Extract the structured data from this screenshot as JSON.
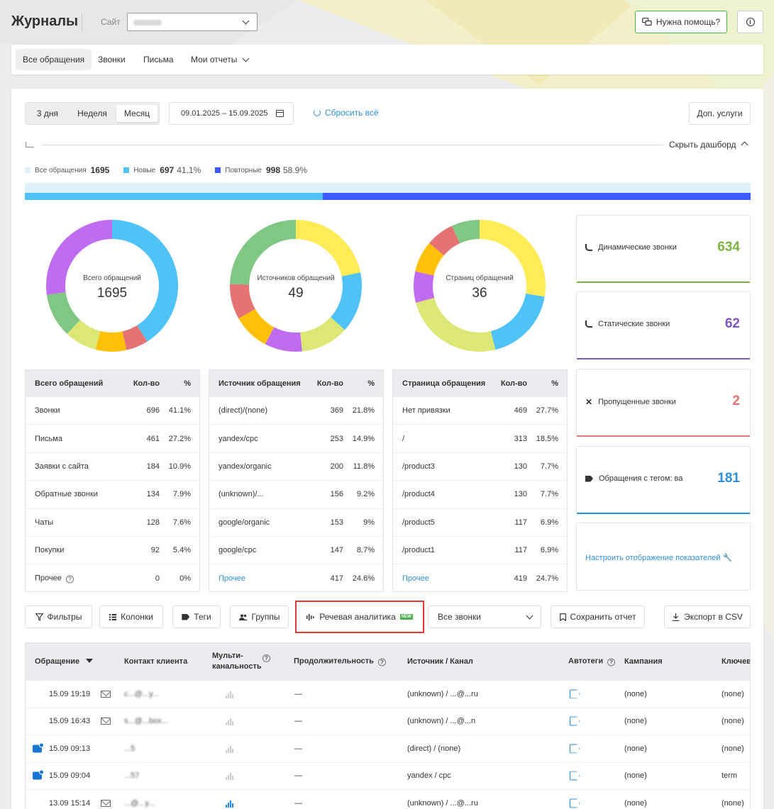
{
  "header": {
    "title": "Журналы",
    "site_label": "Сайт",
    "help_label": "Нужна помощь?"
  },
  "tabs": [
    {
      "label": "Все обращения"
    },
    {
      "label": "Звонки"
    },
    {
      "label": "Письма"
    },
    {
      "label": "Мои отчеты"
    }
  ],
  "period": {
    "options": [
      "3 дня",
      "Неделя",
      "Месяц"
    ],
    "selected": "Месяц",
    "date_range": "09.01.2025 – 15.09.2025",
    "reset_label": "Сбросить всё",
    "extra_services": "Доп. услуги"
  },
  "dashboard": {
    "hide_label": "Скрыть дашборд"
  },
  "summary": {
    "all": {
      "label": "Все обращения",
      "value": "1695"
    },
    "new": {
      "label": "Новые",
      "value": "697",
      "pct": "41.1%"
    },
    "repeat": {
      "label": "Повторные",
      "value": "998",
      "pct": "58.9%"
    }
  },
  "new_share": 0.411,
  "colors": {
    "all": "#ddf2f8",
    "new": "#4fc3f7",
    "repeat": "#3d5afe",
    "dynamic": "#7cb342",
    "static": "#7e57c2",
    "missed": "#e57373",
    "tagged": "#2f8fd6"
  },
  "donuts": [
    {
      "label": "Всего обращений",
      "total": "1695",
      "segments": [
        {
          "value": 696,
          "color": "#4fc3f7"
        },
        {
          "value": 92,
          "color": "#e57373"
        },
        {
          "value": 128,
          "color": "#ffc107"
        },
        {
          "value": 134,
          "color": "#dce775"
        },
        {
          "value": 184,
          "color": "#81c784"
        },
        {
          "value": 461,
          "color": "#c06cf0"
        }
      ]
    },
    {
      "label": "Источников обращений",
      "total": "49",
      "segments": [
        {
          "value": 369,
          "color": "#ffeb55"
        },
        {
          "value": 253,
          "color": "#4fc3f7"
        },
        {
          "value": 200,
          "color": "#dce775"
        },
        {
          "value": 156,
          "color": "#c06cf0"
        },
        {
          "value": 153,
          "color": "#ffc107"
        },
        {
          "value": 147,
          "color": "#e57373"
        },
        {
          "value": 417,
          "color": "#81c784"
        }
      ]
    },
    {
      "label": "Страниц обращений",
      "total": "36",
      "segments": [
        {
          "value": 469,
          "color": "#ffeb55"
        },
        {
          "value": 313,
          "color": "#4fc3f7"
        },
        {
          "value": 419,
          "color": "#dce775"
        },
        {
          "value": 130,
          "color": "#c06cf0"
        },
        {
          "value": 130,
          "color": "#ffc107"
        },
        {
          "value": 117,
          "color": "#e57373"
        },
        {
          "value": 117,
          "color": "#81c784"
        }
      ]
    }
  ],
  "table_all": {
    "headers": [
      "Всего обращений",
      "Кол-во",
      "%"
    ],
    "rows": [
      [
        "Звонки",
        "696",
        "41.1%"
      ],
      [
        "Письма",
        "461",
        "27.2%"
      ],
      [
        "Заявки с сайта",
        "184",
        "10.9%"
      ],
      [
        "Обратные звонки",
        "134",
        "7.9%"
      ],
      [
        "Чаты",
        "128",
        "7.6%"
      ],
      [
        "Покупки",
        "92",
        "5.4%"
      ],
      [
        "Прочее",
        "0",
        "0%"
      ]
    ]
  },
  "table_source": {
    "headers": [
      "Источник обращения",
      "Кол-во",
      "%"
    ],
    "rows": [
      [
        "(direct)/(none)",
        "369",
        "21.8%"
      ],
      [
        "yandex/cpc",
        "253",
        "14.9%"
      ],
      [
        "yandex/organic",
        "200",
        "11.8%"
      ],
      [
        "(unknown)/...",
        "156",
        "9.2%"
      ],
      [
        "google/organic",
        "153",
        "9%"
      ],
      [
        "google/cpc",
        "147",
        "8.7%"
      ],
      [
        "Прочее",
        "417",
        "24.6%"
      ]
    ]
  },
  "table_page": {
    "headers": [
      "Страница обращения",
      "Кол-во",
      "%"
    ],
    "rows": [
      [
        "Нет привязки",
        "469",
        "27.7%"
      ],
      [
        "/",
        "313",
        "18.5%"
      ],
      [
        "/product3",
        "130",
        "7.7%"
      ],
      [
        "/product4",
        "130",
        "7.7%"
      ],
      [
        "/product5",
        "117",
        "6.9%"
      ],
      [
        "/product1",
        "117",
        "6.9%"
      ],
      [
        "Прочее",
        "419",
        "24.7%"
      ]
    ]
  },
  "stats": [
    {
      "label": "Динамические звонки",
      "value": "634"
    },
    {
      "label": "Статические звонки",
      "value": "62"
    },
    {
      "label": "Пропущенные звонки",
      "value": "2"
    },
    {
      "label": "Обращения с тегом: ва",
      "value": "181"
    }
  ],
  "configure_label": "Настроить отображение показателей 🔧",
  "toolbar": {
    "filters": "Фильтры",
    "columns": "Колонки",
    "tags": "Теги",
    "groups": "Группы",
    "speech": "Речевая аналитика",
    "new_badge": "NEW",
    "calls_select": "Все звонки",
    "save_report": "Сохранить отчет",
    "export": "Экспорт в CSV"
  },
  "grid": {
    "headers": {
      "appeal": "Обращение",
      "contact": "Контакт клиента",
      "multi": "Мульти-\nканальность",
      "duration": "Продолжительность",
      "source": "Источник / Канал",
      "autotags": "Автотеги",
      "campaign": "Кампания",
      "keyword": "Ключев"
    },
    "rows": [
      {
        "type": "mail",
        "date": "15.09 19:19",
        "contact": "c...@...y...",
        "dur": "—",
        "source": "(unknown) / ...@...ru",
        "campaign": "(none)",
        "keyword": "(none)",
        "multi": false
      },
      {
        "type": "mail",
        "date": "15.09 16:43",
        "contact": "s...@...box...",
        "dur": "—",
        "source": "(unknown) / ...@...n",
        "campaign": "(none)",
        "keyword": "(none)",
        "multi": false
      },
      {
        "type": "chat",
        "date": "15.09 09:13",
        "contact": "...5",
        "dur": "—",
        "source": "(direct) / (none)",
        "campaign": "(none)",
        "keyword": "(none)",
        "multi": false
      },
      {
        "type": "chat",
        "date": "15.09 09:04",
        "contact": "...57",
        "dur": "—",
        "source": "yandex / cpc",
        "campaign": "(none)",
        "keyword": "term",
        "multi": false
      },
      {
        "type": "mail",
        "date": "13.09 15:14",
        "contact": "...@...y...",
        "dur": "—",
        "source": "(unknown) / ...@...ru",
        "campaign": "(none)",
        "keyword": "(none)",
        "multi": true
      }
    ]
  }
}
